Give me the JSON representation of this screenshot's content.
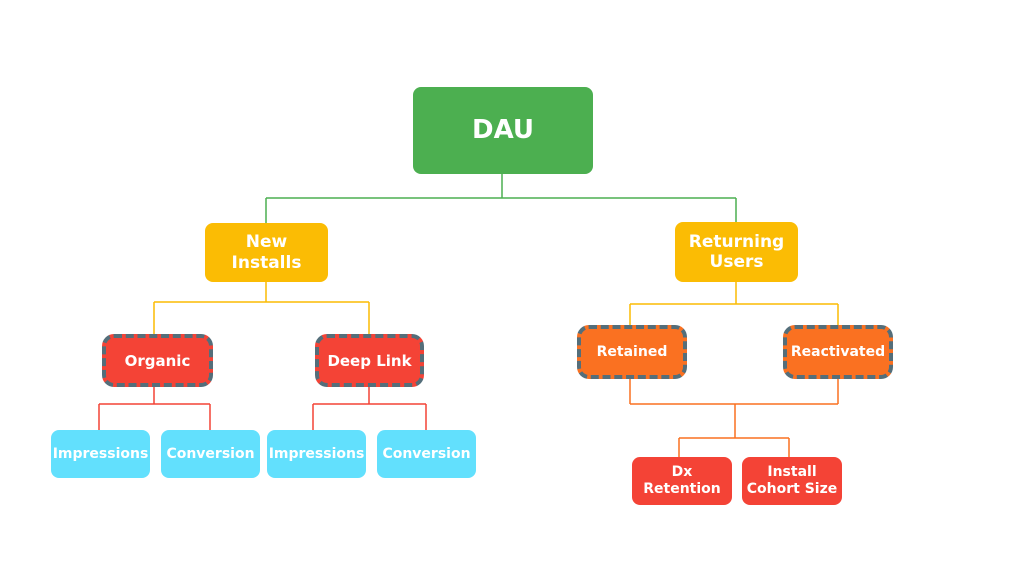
{
  "colors": {
    "root": "#4caf50",
    "level1": "#fbbc04",
    "new_children": "#f44336",
    "returning_children": "#fa7121",
    "leaf_cyan": "#62e0fd",
    "leaf_red": "#f44336",
    "dashed_border": "#546e7a"
  },
  "root": {
    "label": "DAU"
  },
  "new_installs": {
    "label": "New Installs",
    "organic": {
      "label": "Organic",
      "children": [
        "Impressions",
        "Conversion"
      ]
    },
    "deep_link": {
      "label": "Deep Link",
      "children": [
        "Impressions",
        "Conversion"
      ]
    }
  },
  "returning_users": {
    "label": "Returning Users",
    "retained": {
      "label": "Retained"
    },
    "reactivated": {
      "label": "Reactivated"
    },
    "children": [
      "Dx Retention",
      "Install Cohort Size"
    ]
  }
}
